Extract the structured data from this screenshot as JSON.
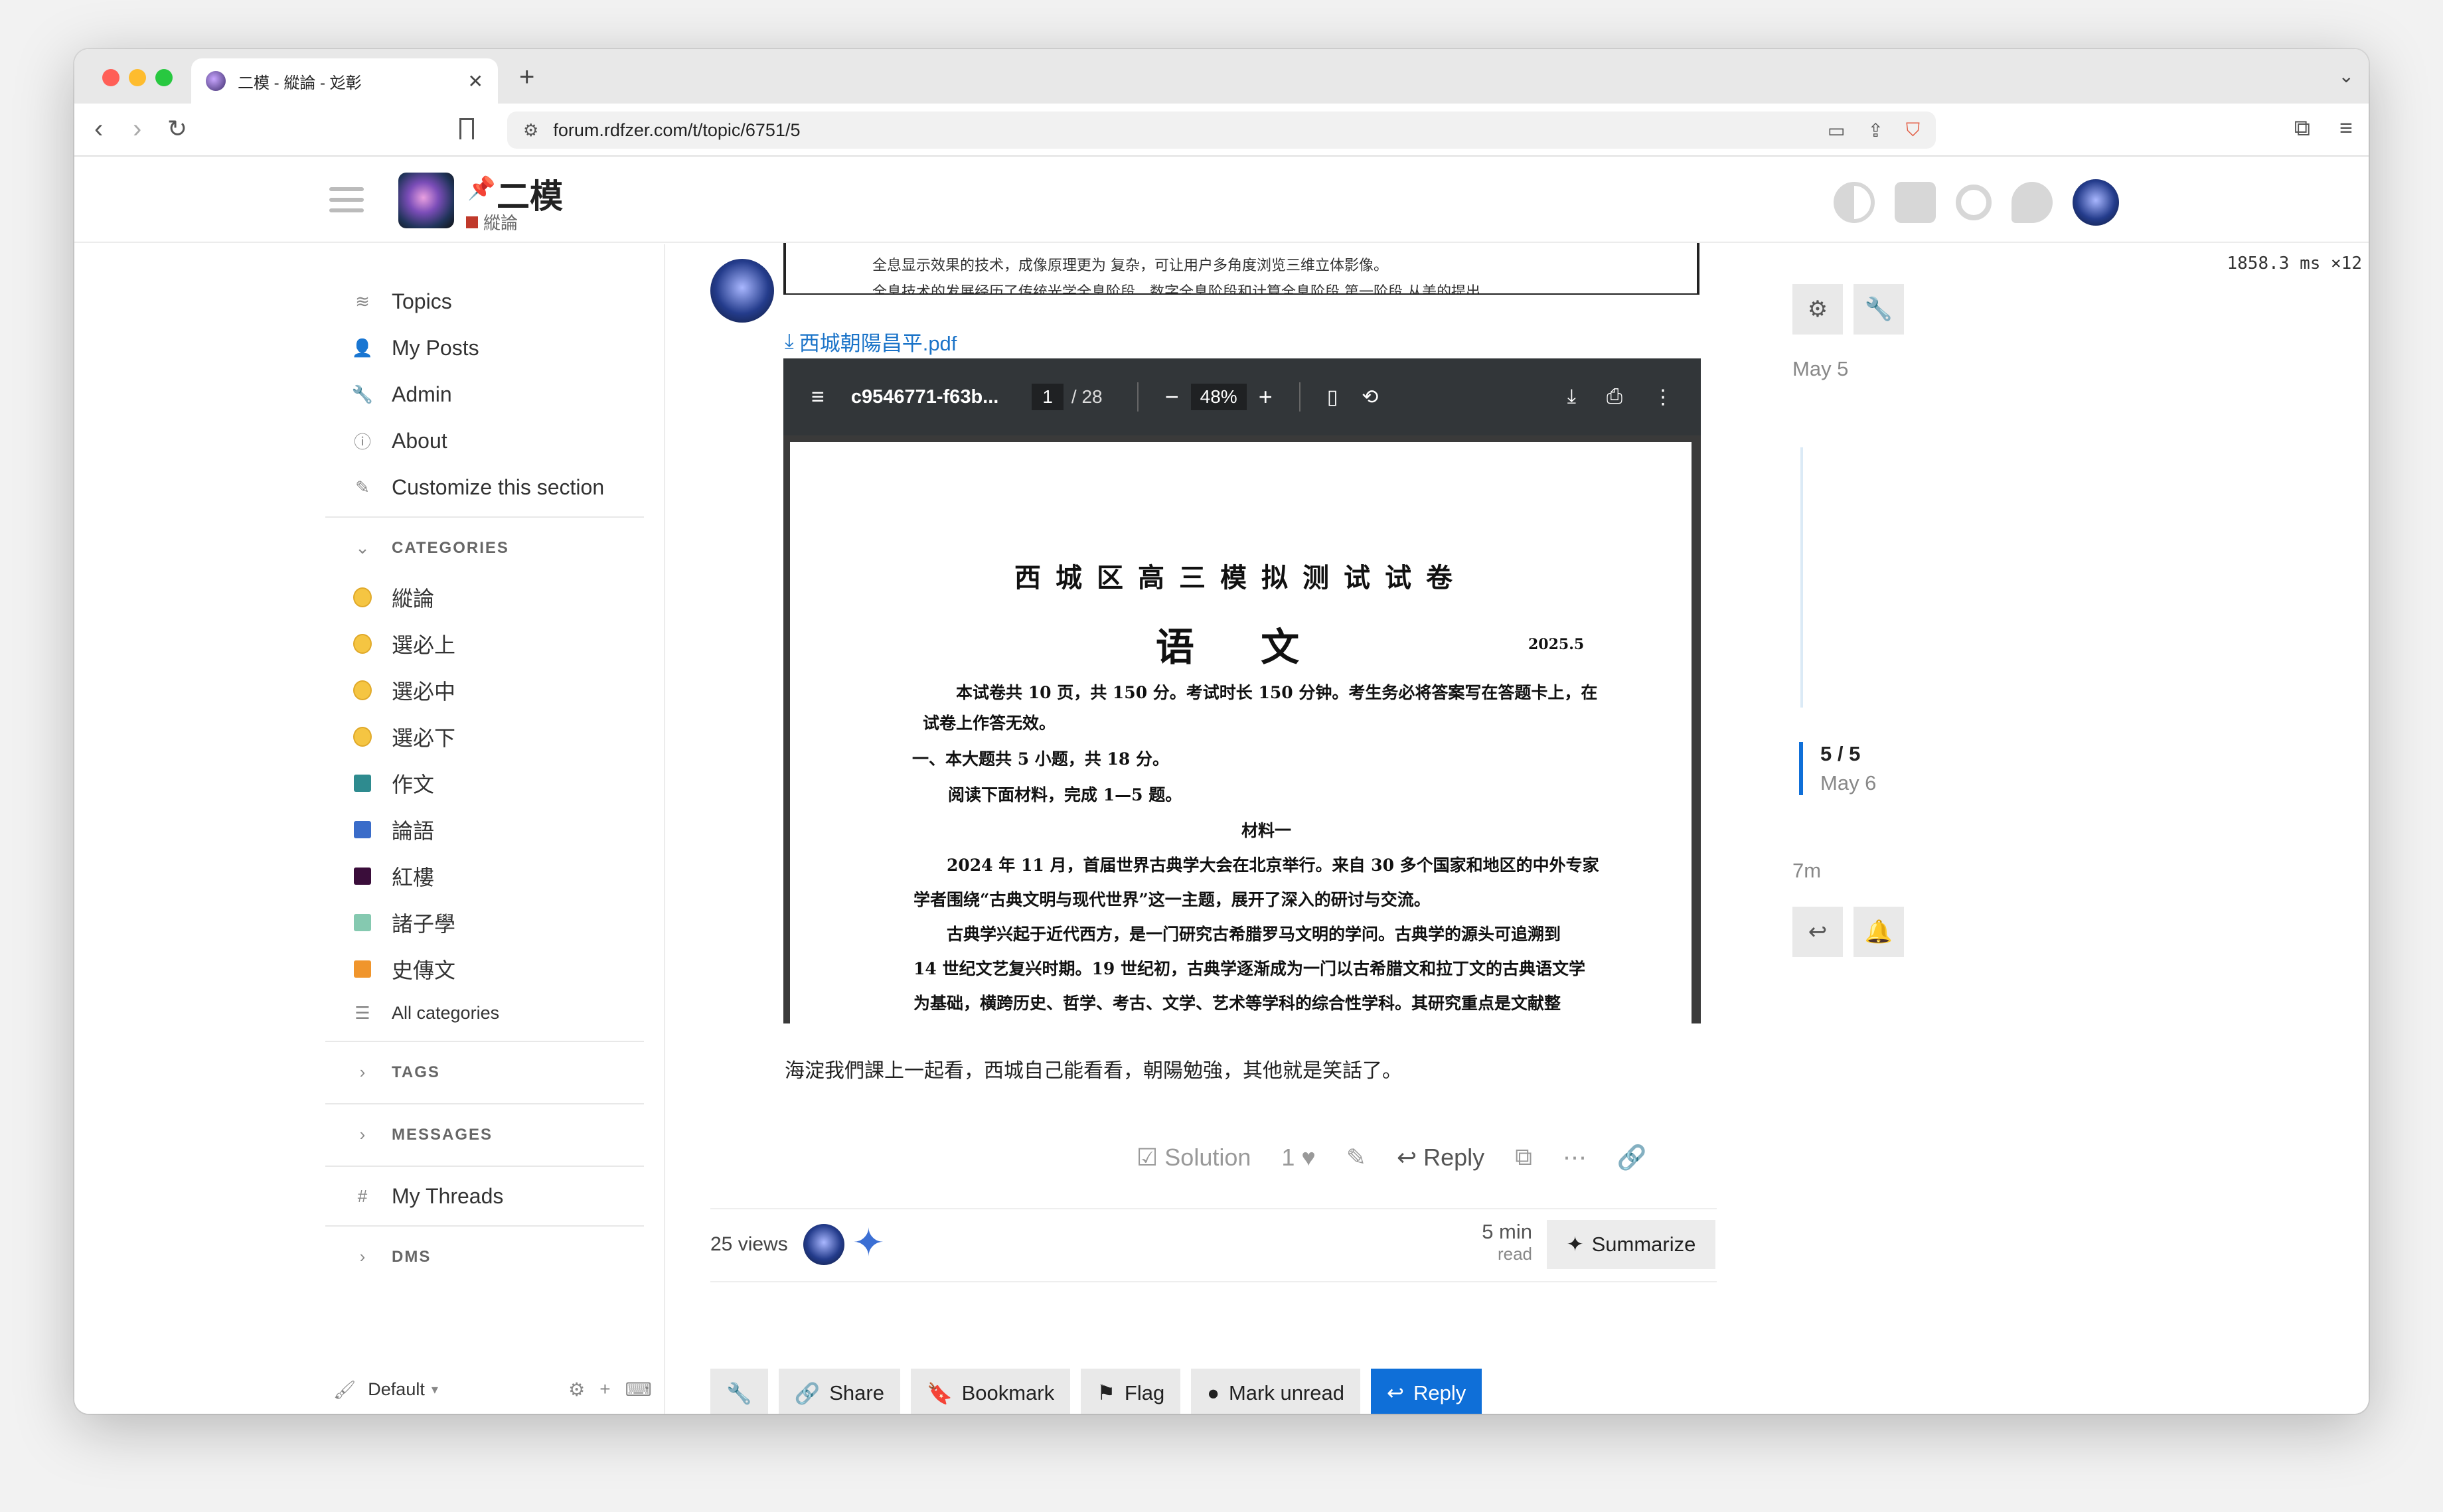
{
  "browser": {
    "tab_title": "二模 - 縱論 - 彣彰",
    "new_tab": "+",
    "url": "forum.rdfzer.com/t/topic/6751/5"
  },
  "header": {
    "title": "二模",
    "category": "縱論",
    "timing": "1858.3 ms ×12"
  },
  "sidebar": {
    "items": [
      {
        "label": "Topics",
        "icon": "layers-icon"
      },
      {
        "label": "My Posts",
        "icon": "user-icon"
      },
      {
        "label": "Admin",
        "icon": "wrench-icon"
      },
      {
        "label": "About",
        "icon": "info-icon"
      },
      {
        "label": "Customize this section",
        "icon": "pencil-icon"
      }
    ],
    "categories_heading": "CATEGORIES",
    "categories": [
      {
        "label": "縱論",
        "kind": "emoji",
        "color": "#f5c542"
      },
      {
        "label": "選必上",
        "kind": "emoji",
        "color": "#f5c542"
      },
      {
        "label": "選必中",
        "kind": "emoji",
        "color": "#f5c542"
      },
      {
        "label": "選必下",
        "kind": "emoji",
        "color": "#f5c542"
      },
      {
        "label": "作文",
        "kind": "square",
        "color": "#2e8b8f"
      },
      {
        "label": "論語",
        "kind": "square",
        "color": "#3a6cc9"
      },
      {
        "label": "紅樓",
        "kind": "square",
        "color": "#3a0d3a"
      },
      {
        "label": "諸子學",
        "kind": "square",
        "color": "#85c9b0"
      },
      {
        "label": "史傳文",
        "kind": "square",
        "color": "#f0952c"
      }
    ],
    "all_categories": "All categories",
    "tags_heading": "TAGS",
    "messages_heading": "MESSAGES",
    "my_threads": "My Threads",
    "dms_heading": "DMS",
    "footer_theme": "Default"
  },
  "post": {
    "prev_doc_line1": "全息显示效果的技术，成像原理更为 复杂，可让用户多角度浏览三维立体影像。",
    "prev_doc_line2": "全息技术的发展经历了传统光学全息阶段、数字全息阶段和计算全息阶段 第一阶段 从美的提出",
    "attachment": "西城朝陽昌平.pdf",
    "pdf": {
      "filename": "c9546771-f63b...",
      "page": "1",
      "total_pages": "/ 28",
      "zoom": "48%",
      "title": "西城区高三模拟测试试卷",
      "subject": "语 文",
      "date": "2025.5",
      "lines": [
        "本试卷共 10 页，共 150 分。考试时长 150 分钟。考生务必将答案写在答题卡上，在",
        "试卷上作答无效。",
        "一、本大题共 5 小题，共 18 分。",
        "阅读下面材料，完成 1—5 题。",
        "材料一",
        "2024 年 11 月，首届世界古典学大会在北京举行。来自 30 多个国家和地区的中外专家",
        "学者围绕“古典文明与现代世界”这一主题，展开了深入的研讨与交流。",
        "古典学兴起于近代西方，是一门研究古希腊罗马文明的学问。古典学的源头可追溯到",
        "14 世纪文艺复兴时期。19 世纪初，古典学逐渐成为一门以古希腊文和拉丁文的古典语文学",
        "为基础，横跨历史、哲学、考古、文学、艺术等学科的综合性学科。其研究重点是文献整"
      ]
    },
    "text": "海淀我們課上一起看，西城自己能看看，朝陽勉強，其他就是笑話了。",
    "controls": {
      "solution": "Solution",
      "likes": "1",
      "reply": "Reply"
    }
  },
  "topic_map": {
    "views": "25 views",
    "read_time": "5 min",
    "read_label": "read",
    "summarize": "Summarize"
  },
  "footer_buttons": {
    "share": "Share",
    "bookmark": "Bookmark",
    "flag": "Flag",
    "mark_unread": "Mark unread",
    "reply": "Reply"
  },
  "timeline": {
    "start_date": "May 5",
    "position": "5 / 5",
    "position_date": "May 6",
    "end_date": "7m"
  }
}
